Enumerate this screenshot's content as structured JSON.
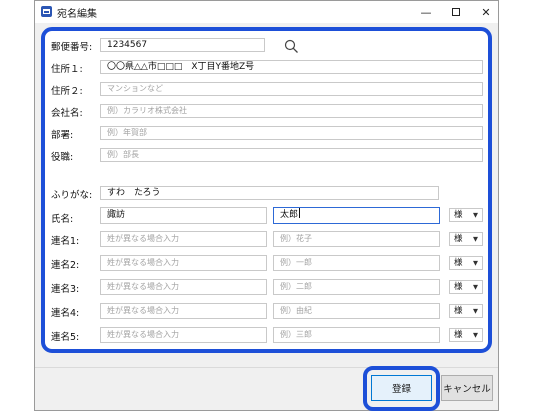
{
  "window": {
    "title": "宛名編集"
  },
  "titlebar": {
    "minimize": "—",
    "close": "✕"
  },
  "form": {
    "postal": {
      "label": "郵便番号:",
      "value": "1234567"
    },
    "address1": {
      "label": "住所１:",
      "value": "〇〇県△△市□□□　X丁目Y番地Z号"
    },
    "address2": {
      "label": "住所２:",
      "placeholder": "マンションなど"
    },
    "company": {
      "label": "会社名:",
      "placeholder": "例）カラリオ株式会社"
    },
    "department": {
      "label": "部署:",
      "placeholder": "例）年賀部"
    },
    "position": {
      "label": "役職:",
      "placeholder": "例）部長"
    },
    "furigana": {
      "label": "ふりがな:",
      "value": "すわ　たろう"
    },
    "name": {
      "label": "氏名:",
      "last": "諏訪",
      "first": "太郎",
      "honorific": "様"
    },
    "joint": [
      {
        "label": "連名1:",
        "last_placeholder": "姓が異なる場合入力",
        "first_placeholder": "例）花子",
        "honorific": "様"
      },
      {
        "label": "連名2:",
        "last_placeholder": "姓が異なる場合入力",
        "first_placeholder": "例）一郎",
        "honorific": "様"
      },
      {
        "label": "連名3:",
        "last_placeholder": "姓が異なる場合入力",
        "first_placeholder": "例）二郎",
        "honorific": "様"
      },
      {
        "label": "連名4:",
        "last_placeholder": "姓が異なる場合入力",
        "first_placeholder": "例）由紀",
        "honorific": "様"
      },
      {
        "label": "連名5:",
        "last_placeholder": "姓が異なる場合入力",
        "first_placeholder": "例）三郎",
        "honorific": "様"
      }
    ]
  },
  "footer": {
    "register": "登録",
    "cancel": "キャンセル"
  },
  "colors": {
    "highlight": "#1d4fd8",
    "focus_border": "#2d69d6"
  }
}
